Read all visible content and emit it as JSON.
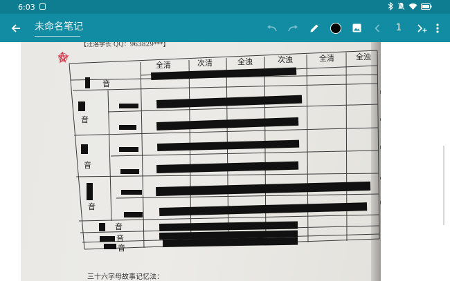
{
  "status_bar": {
    "time": "6:03",
    "icons": [
      "bluetooth-icon",
      "mute-icon",
      "wifi-icon",
      "battery-icon"
    ]
  },
  "toolbar": {
    "back_icon": "arrow-left-icon",
    "title": "未命名笔记",
    "tools": [
      "undo-icon",
      "redo-icon",
      "pen-icon",
      "color-swatch",
      "image-icon",
      "prev-page-icon",
      "next-page-icon",
      "more-icon"
    ],
    "ink_color": "#000000",
    "page": "1"
  },
  "note_photo": {
    "header_text": "【汪洛学长 QQ：963829***】",
    "table_header": [
      "全清",
      "次清",
      "全浊",
      "次浊",
      "全清",
      "全浊"
    ],
    "row_labels": [
      "音",
      "音",
      "音",
      "音",
      "音",
      "音",
      "音"
    ],
    "footer_text": "三十六字母故事记忆法："
  },
  "colors": {
    "status_bar": "#0e7d91",
    "toolbar": "#128ca2",
    "star_mark": "#d9374b"
  }
}
